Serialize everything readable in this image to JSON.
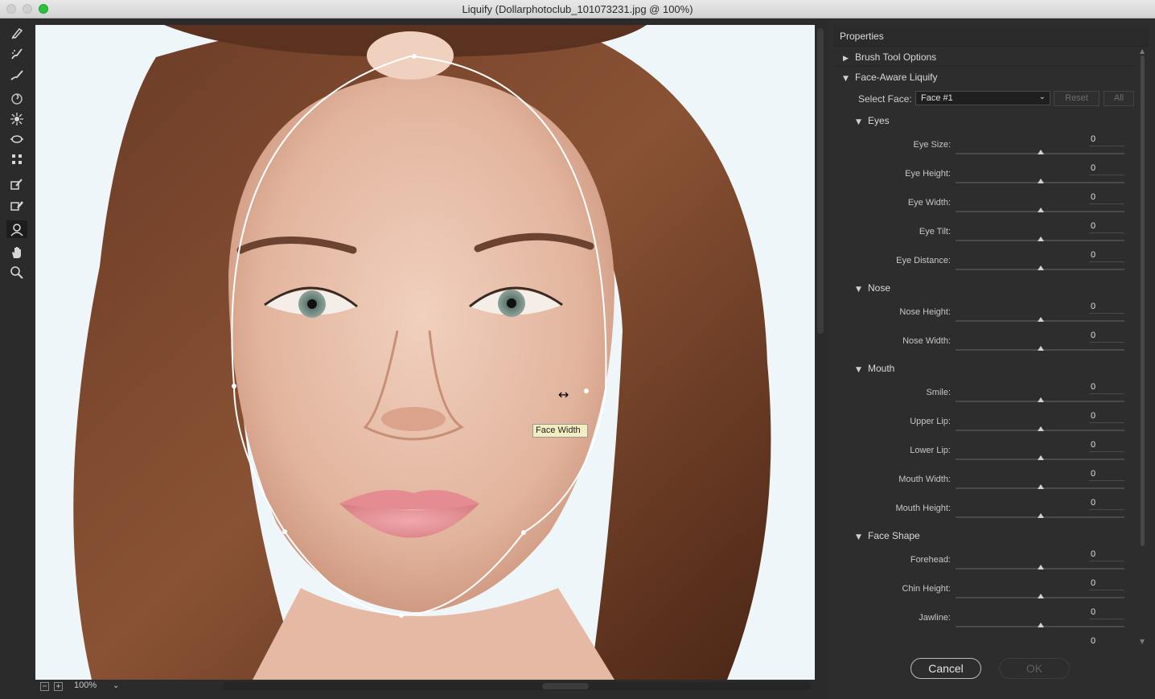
{
  "window": {
    "title": "Liquify (Dollarphotoclub_101073231.jpg @ 100%)"
  },
  "tools": [
    "forward-warp",
    "reconstruct",
    "smooth",
    "twirl-clockwise",
    "pucker",
    "bloat",
    "push-left",
    "freeze-mask",
    "thaw-mask",
    "face",
    "hand",
    "zoom"
  ],
  "canvas": {
    "tooltip": "Face Width",
    "zoom": "100%"
  },
  "panel": {
    "header": "Properties",
    "brush_tool_options": "Brush Tool Options",
    "face_aware": "Face-Aware Liquify",
    "select_face_label": "Select Face:",
    "select_face_value": "Face #1",
    "reset": "Reset",
    "all": "All",
    "eyes": {
      "title": "Eyes",
      "eye_size": "Eye Size:",
      "eye_size_val": "0",
      "eye_height": "Eye Height:",
      "eye_height_val": "0",
      "eye_width": "Eye Width:",
      "eye_width_val": "0",
      "eye_tilt": "Eye Tilt:",
      "eye_tilt_val": "0",
      "eye_distance": "Eye Distance:",
      "eye_distance_val": "0"
    },
    "nose": {
      "title": "Nose",
      "nose_height": "Nose Height:",
      "nose_height_val": "0",
      "nose_width": "Nose Width:",
      "nose_width_val": "0"
    },
    "mouth": {
      "title": "Mouth",
      "smile": "Smile:",
      "smile_val": "0",
      "upper_lip": "Upper Lip:",
      "upper_lip_val": "0",
      "lower_lip": "Lower Lip:",
      "lower_lip_val": "0",
      "mouth_width": "Mouth Width:",
      "mouth_width_val": "0",
      "mouth_height": "Mouth Height:",
      "mouth_height_val": "0"
    },
    "face_shape": {
      "title": "Face Shape",
      "forehead": "Forehead:",
      "forehead_val": "0",
      "chin_height": "Chin Height:",
      "chin_height_val": "0",
      "jawline": "Jawline:",
      "jawline_val": "0",
      "face_width_val": "0"
    }
  },
  "buttons": {
    "cancel": "Cancel",
    "ok": "OK"
  }
}
